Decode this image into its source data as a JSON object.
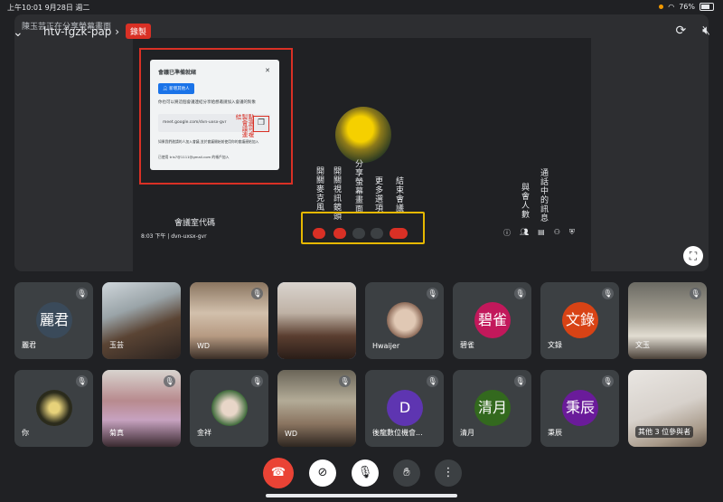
{
  "status": {
    "time_date": "上午10:01  9月28日 週二",
    "battery": "76%"
  },
  "top": {
    "presenter": "陳玉芸正在分享螢幕畫面",
    "meeting_code": "htv-fgzk-pap",
    "rec": "錄製"
  },
  "presentation": {
    "dialog_title": "會議已準備就緒",
    "dialog_button": "新增其他人",
    "dialog_body": "你也可以將這個會議連結分享給想邀請加入會議的對象",
    "dialog_link": "meet.google.com/dvn-uxsx-gvr",
    "copy_note": "點選可複製會議連結",
    "dialog_footer1": "如果我們邀請的人加入會議,並於會議開始前使用你的會議連結加入",
    "dialog_footer2": "已使用 tris7@1111@gmail.com 的帳戶加入",
    "annot_mic": "開關麥克風",
    "annot_cam": "開關視訊鏡頭",
    "annot_share": "分享螢幕畫面",
    "annot_more": "更多選項",
    "annot_end": "結束會議",
    "annot_people": "與會人數",
    "annot_chat": "通話中的訊息",
    "code_label": "會議室代碼",
    "time_code": "8:03 下午 | dvn-uxsx-gvr"
  },
  "tiles_row1": [
    {
      "name": "麗君",
      "avatar": "麗君",
      "color": "#3a4a5a"
    },
    {
      "name": "玉芸"
    },
    {
      "name": "WD"
    },
    {
      "name": ""
    },
    {
      "name": "Hwaijer"
    },
    {
      "name": "碧雀",
      "avatar": "碧雀",
      "color": "#c2185b"
    },
    {
      "name": "文錄",
      "avatar": "文錄",
      "color": "#d84315"
    },
    {
      "name": "文玉"
    }
  ],
  "tiles_row2": [
    {
      "name": "你"
    },
    {
      "name": "菊真"
    },
    {
      "name": "金祥"
    },
    {
      "name": "WD"
    },
    {
      "name": "後龍數位機會...",
      "avatar": "D",
      "color": "#5e35b1"
    },
    {
      "name": "清月",
      "avatar": "清月",
      "color": "#33691e"
    },
    {
      "name": "秉辰",
      "avatar": "秉辰",
      "color": "#6a1b9a"
    },
    {
      "name": "其他 3 位參與者"
    }
  ],
  "icons": [
    "chevron-down-icon",
    "camera-switch-icon",
    "speaker-off-icon",
    "mic-off-icon",
    "end-call-icon",
    "camera-off-icon",
    "hand-raise-icon",
    "more-icon",
    "fullscreen-icon"
  ]
}
